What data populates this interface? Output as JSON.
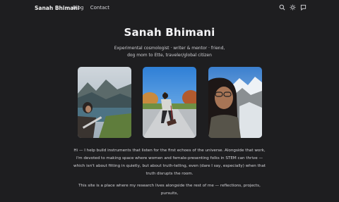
{
  "nav": {
    "brand": "Sanah Bhimani",
    "links": [
      "Blog",
      "Contact"
    ],
    "icons": [
      "search-icon",
      "sun-icon",
      "message-icon"
    ]
  },
  "hero": {
    "title": "Sanah Bhimani",
    "tagline_line1": "Experimental cosmologist · writer & mentor · friend,",
    "tagline_line2": "dog mom to Ette, traveler/global citizen"
  },
  "photos": [
    {
      "subject": "selfie-by-fjord"
    },
    {
      "subject": "with-dog-on-path"
    },
    {
      "subject": "selfie-by-snowy-mountains"
    }
  ],
  "bio": {
    "p1": "Hi — I help build instruments that listen for the first echoes of the universe. Alongside that work, I'm devoted to making space where women and female-presenting folks in STEM can thrive — which isn't about fitting in quietly, but about truth-telling, even (dare I say, especially) when that truth disrupts the room.",
    "p2": "This site is a place where my research lives alongside the rest of me — reflections, projects, pursuits,"
  },
  "colors": {
    "background": "#1e1e20",
    "text": "#e8e8ea"
  }
}
